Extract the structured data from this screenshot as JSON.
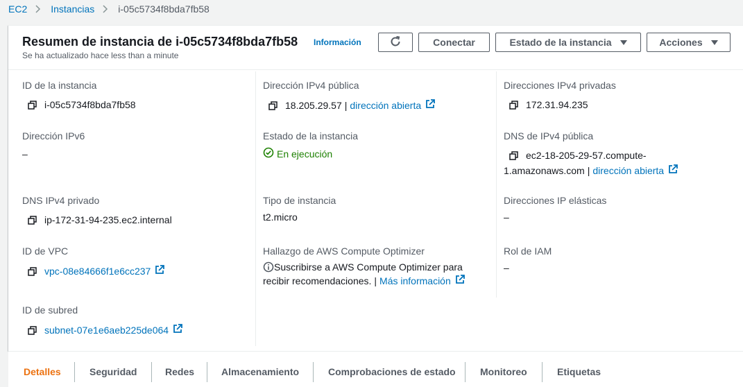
{
  "breadcrumb": {
    "root": "EC2",
    "section": "Instancias",
    "current": "i-05c5734f8bda7fb58"
  },
  "header": {
    "title": "Resumen de instancia de i-05c5734f8bda7fb58",
    "info": "Información",
    "subtitle": "Se ha actualizado hace less than a minute",
    "buttons": {
      "connect": "Conectar",
      "state": "Estado de la instancia",
      "actions": "Acciones"
    }
  },
  "fields": {
    "instance_id": {
      "label": "ID de la instancia",
      "value": "i-05c5734f8bda7fb58"
    },
    "ipv6": {
      "label": "Dirección IPv6",
      "value": "–"
    },
    "private_dns": {
      "label": "DNS IPv4 privado",
      "value": "ip-172-31-94-235.ec2.internal"
    },
    "vpc": {
      "label": "ID de VPC",
      "value": "vpc-08e84666f1e6cc237"
    },
    "subnet": {
      "label": "ID de subred",
      "value": "subnet-07e1e6aeb225de064"
    },
    "public_ip": {
      "label": "Dirección IPv4 pública",
      "value": "18.205.29.57",
      "link": "dirección abierta"
    },
    "state": {
      "label": "Estado de la instancia",
      "value": "En ejecución"
    },
    "type": {
      "label": "Tipo de instancia",
      "value": "t2.micro"
    },
    "optimizer": {
      "label": "Hallazgo de AWS Compute Optimizer",
      "line1": "Suscribirse a AWS Compute Optimizer para",
      "line2": "recibir recomendaciones.",
      "link": "Más información"
    },
    "private_ips": {
      "label": "Direcciones IPv4 privadas",
      "value": "172.31.94.235"
    },
    "public_dns": {
      "label": "DNS de IPv4 pública",
      "line1": "ec2-18-205-29-57.compute-",
      "line2": "1.amazonaws.com",
      "link": "dirección abierta"
    },
    "elastic_ips": {
      "label": "Direcciones IP elásticas",
      "value": "–"
    },
    "iam_role": {
      "label": "Rol de IAM",
      "value": "–"
    }
  },
  "tabs": [
    "Detalles",
    "Seguridad",
    "Redes",
    "Almacenamiento",
    "Comprobaciones de estado",
    "Monitoreo",
    "Etiquetas"
  ],
  "colors": {
    "link": "#0073bb",
    "active_tab": "#ec7211",
    "running": "#1d8102"
  }
}
